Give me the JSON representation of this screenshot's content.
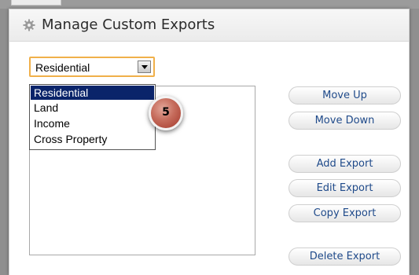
{
  "header": {
    "title": "Manage Custom Exports",
    "icon": "gear-icon"
  },
  "select": {
    "value": "Residential"
  },
  "dropdown": {
    "options": [
      "Residential",
      "Land",
      "Income",
      "Cross Property"
    ],
    "selected_index": 0
  },
  "callout": {
    "number": "5"
  },
  "buttons": {
    "move_up": "Move Up",
    "move_down": "Move Down",
    "add_export": "Add Export",
    "edit_export": "Edit Export",
    "copy_export": "Copy Export",
    "delete_export": "Delete Export"
  },
  "colors": {
    "selection": "#0a246a",
    "button_text": "#1f4a8a",
    "select_focus_border": "#f0b04a",
    "callout": "#c56b5b"
  }
}
